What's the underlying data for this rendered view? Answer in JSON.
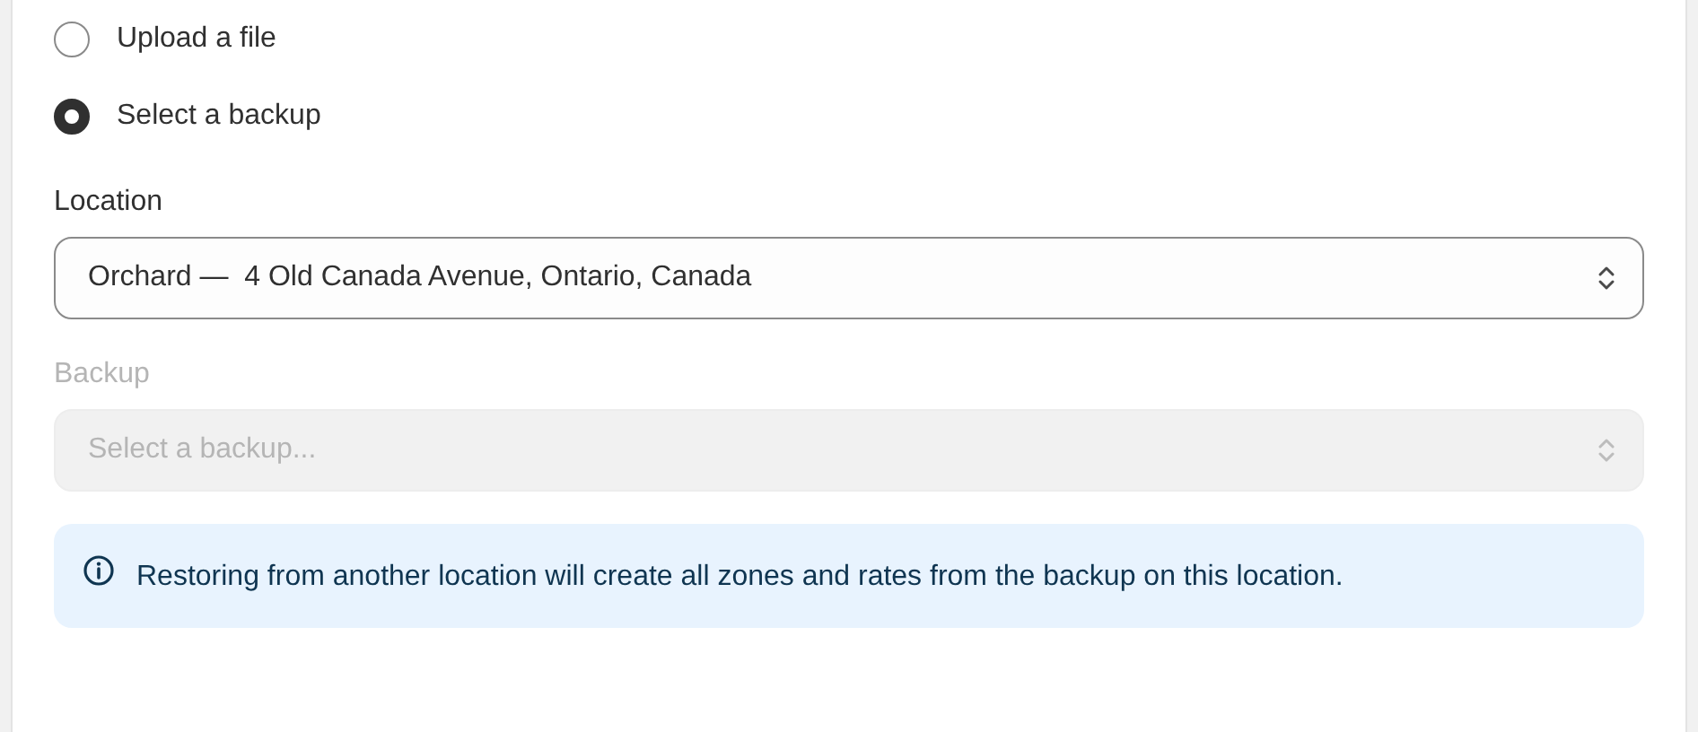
{
  "source_options": [
    {
      "label": "Upload a file",
      "selected": false
    },
    {
      "label": "Select a backup",
      "selected": true
    }
  ],
  "location": {
    "label": "Location",
    "value": "Orchard —  4 Old Canada Avenue, Ontario, Canada",
    "disabled": false
  },
  "backup": {
    "label": "Backup",
    "placeholder": "Select a backup...",
    "disabled": true
  },
  "banner": {
    "text": "Restoring from another location will create all zones and rates from the backup on this location."
  }
}
